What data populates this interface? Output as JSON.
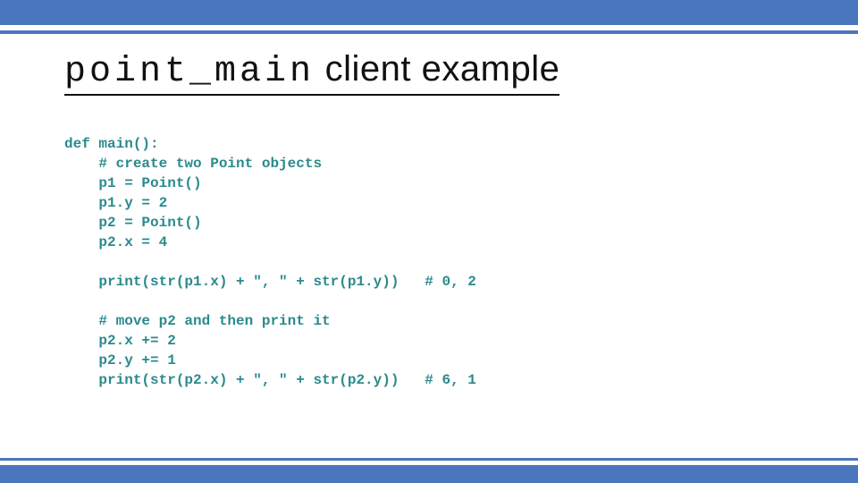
{
  "title": {
    "mono": "point_main",
    "rest": " client example"
  },
  "code": {
    "l0": "def main():",
    "l1": "    # create two Point objects",
    "l2": "    p1 = Point()",
    "l3": "    p1.y = 2",
    "l4": "    p2 = Point()",
    "l5": "    p2.x = 4",
    "l6": "",
    "l7": "    print(str(p1.x) + \", \" + str(p1.y))   # 0, 2",
    "l8": "",
    "l9": "    # move p2 and then print it",
    "l10": "    p2.x += 2",
    "l11": "    p2.y += 1",
    "l12": "    print(str(p2.x) + \", \" + str(p2.y))   # 6, 1"
  }
}
